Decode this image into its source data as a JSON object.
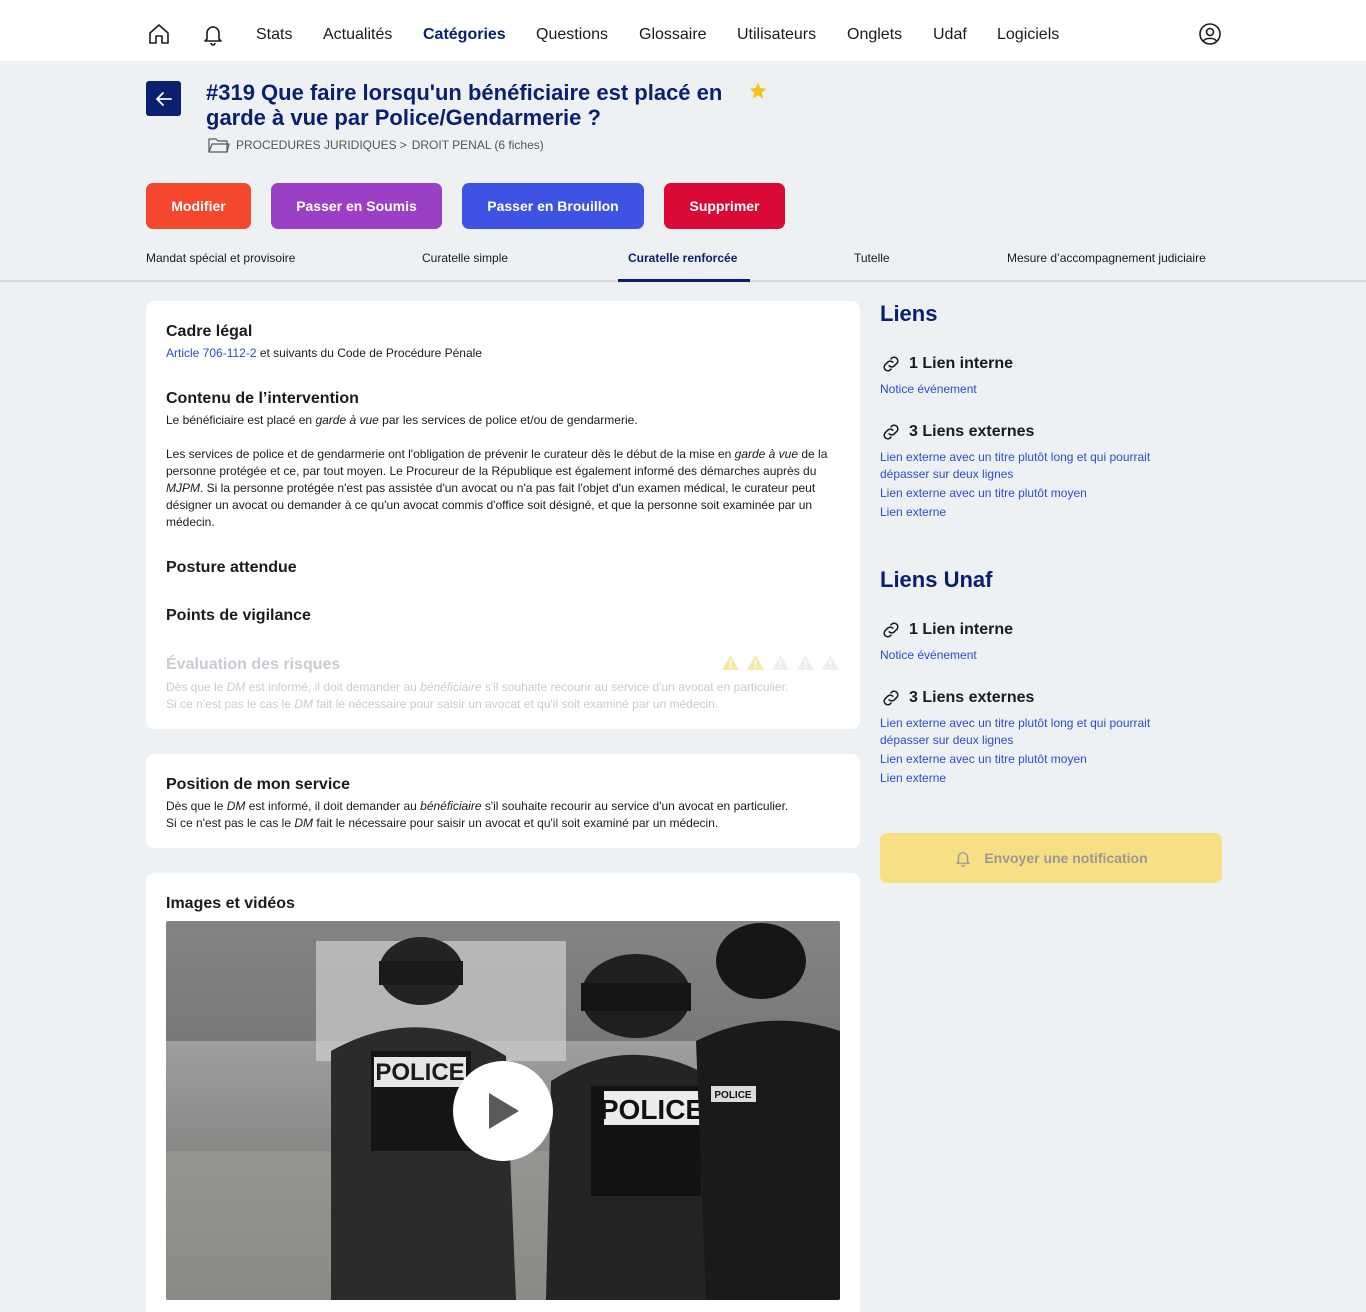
{
  "nav": {
    "items": [
      {
        "label": "Stats"
      },
      {
        "label": "Actualités"
      },
      {
        "label": "Catégories"
      },
      {
        "label": "Questions"
      },
      {
        "label": "Glossaire"
      },
      {
        "label": "Utilisateurs"
      },
      {
        "label": "Onglets"
      },
      {
        "label": "Udaf"
      },
      {
        "label": "Logiciels"
      }
    ],
    "active": "Catégories"
  },
  "header": {
    "title": "#319 Que faire lorsqu'un bénéficiaire est placé en garde à vue par Police/Gendarmerie ?",
    "breadcrumb": {
      "parent": "PROCEDURES JURIDIQUES",
      "separator": ">",
      "current": "DROIT PENAL (6 fiches)"
    }
  },
  "actions": {
    "modify": "Modifier",
    "submit": "Passer en Soumis",
    "draft": "Passer en Brouillon",
    "delete": "Supprimer"
  },
  "colors": {
    "accent": "#0a1f6e",
    "modify": "#f4472e",
    "submit": "#9b3fc4",
    "draft": "#3e53e3",
    "delete": "#d90a35",
    "notify": "#f6df84",
    "link": "#2d4bd6",
    "warning": "#f6d14a"
  },
  "tabs": [
    {
      "label": "Mandat spécial et provisoire"
    },
    {
      "label": "Curatelle simple"
    },
    {
      "label": "Curatelle renforcée"
    },
    {
      "label": "Tutelle"
    },
    {
      "label": "Mesure d’accompagnement judiciaire"
    }
  ],
  "active_tab": "Curatelle renforcée",
  "main": {
    "cadre": {
      "heading": "Cadre légal",
      "link": "Article 706-112-2",
      "text": " et suivants du Code de Procédure Pénale"
    },
    "contenu": {
      "heading": "Contenu de l’intervention",
      "p1_a": "Le bénéficiaire est placé en ",
      "p1_em": "garde à vue",
      "p1_b": " par les services de police et/ou de gendarmerie.",
      "p2_a": "Les services de police et de gendarmerie ont l'obligation de prévenir le curateur dès le début de la mise en ",
      "p2_em1": "garde à vue",
      "p2_b": " de la personne protégée et ce, par tout moyen. Le Procureur de la République est également informé des démarches auprès du ",
      "p2_em2": "MJPM",
      "p2_c": ". Si la personne protégée n'est pas assistée d'un avocat ou n'a pas fait l'objet d'un examen médical, le curateur peut désigner un avocat ou demander à ce qu'un avocat commis d'office soit désigné, et que la personne soit examinée par un médecin."
    },
    "posture": {
      "heading": "Posture attendue"
    },
    "vigilance": {
      "heading": "Points de vigilance"
    },
    "risques": {
      "heading": "Évaluation des risques",
      "level": 2,
      "max": 5,
      "l1_a": "Dès que le ",
      "l1_em1": "DM",
      "l1_b": " est informé, il doit demander au ",
      "l1_em2": "bénéficiaire",
      "l1_c": " s'il souhaite recourir au service d'un avocat en particulier.",
      "l2_a": "Si ce n'est pas le cas le ",
      "l2_em": "DM",
      "l2_b": " fait le nécessaire pour saisir un avocat et qu'il soit examiné par un médecin."
    },
    "position": {
      "heading": "Position de mon service",
      "l1_a": "Dès que le ",
      "l1_em1": "DM",
      "l1_b": " est informé, il doit demander au ",
      "l1_em2": "bénéficiaire",
      "l1_c": " s'il souhaite recourir au service d'un avocat en particulier.",
      "l2_a": "Si ce n'est pas le cas le ",
      "l2_em": "DM",
      "l2_b": " fait le nécessaire pour saisir un avocat et qu'il soit examiné par un médecin."
    },
    "media": {
      "heading": "Images et vidéos",
      "badge1": "POLICE",
      "badge2": "POLICE",
      "badge3": "POLICE"
    }
  },
  "sidebar": {
    "liens": {
      "title": "Liens",
      "internal_heading": "1 Lien interne",
      "internal_links": [
        "Notice événement"
      ],
      "external_heading": "3 Liens externes",
      "external_links": [
        "Lien externe avec un titre plutôt long et qui pourrait dépasser sur deux lignes",
        "Lien externe avec un titre plutôt moyen",
        "Lien externe"
      ]
    },
    "liens_unaf": {
      "title": "Liens Unaf",
      "internal_heading": "1 Lien interne",
      "internal_links": [
        "Notice événement"
      ],
      "external_heading": "3 Liens externes",
      "external_links": [
        "Lien externe avec un titre plutôt long et qui pourrait dépasser sur deux lignes",
        "Lien externe avec un titre plutôt moyen",
        "Lien externe"
      ]
    },
    "notify_label": "Envoyer une notification"
  }
}
